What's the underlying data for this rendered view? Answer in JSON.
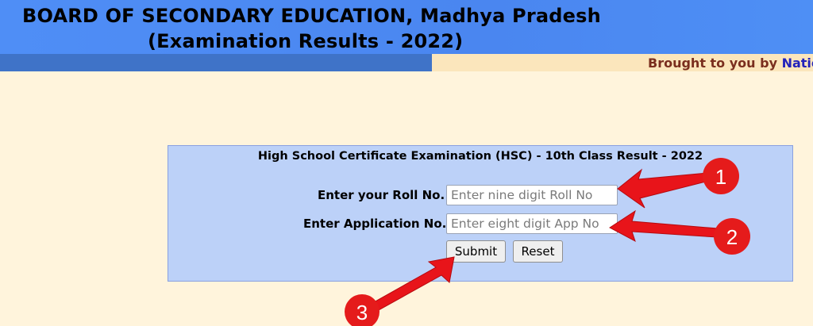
{
  "header": {
    "title_line1": "BOARD OF SECONDARY EDUCATION, Madhya Pradesh",
    "title_line2": "(Examination Results - 2022)"
  },
  "marquee": {
    "text": "Brought to you by ",
    "link_text": "Natio"
  },
  "form": {
    "title": "High School Certificate Examination (HSC) - 10th Class Result - 2022",
    "roll_label": "Enter your Roll No.",
    "roll_placeholder": "Enter nine digit Roll No",
    "roll_value": "",
    "app_label": "Enter Application No.",
    "app_placeholder": "Enter eight digit App No",
    "app_value": "",
    "submit_label": "Submit",
    "reset_label": "Reset"
  },
  "annotations": {
    "badge_1": "1",
    "badge_2": "2",
    "badge_3": "3",
    "arrow_color": "#e8141a",
    "badge_color": "#e51b1b"
  },
  "colors": {
    "header_blue": "#4f8ef6",
    "band_blue": "#3f73c8",
    "page_bg": "#fff4dc",
    "panel_bg": "#bcd1f8"
  }
}
